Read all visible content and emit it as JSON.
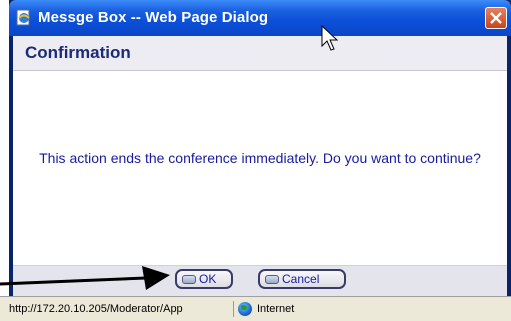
{
  "window": {
    "title": "Messge Box -- Web Page Dialog",
    "close_icon": "close-icon"
  },
  "dialog": {
    "heading": "Confirmation",
    "message": "This action ends the conference immediately. Do you want to continue?",
    "buttons": {
      "ok_label": "OK",
      "cancel_label": "Cancel"
    }
  },
  "statusbar": {
    "url": "http://172.20.10.205/Moderator/App",
    "zone": "Internet"
  },
  "colors": {
    "title_bar": "#0b4fd8",
    "heading_text": "#1c2a7a",
    "message_text": "#1a1aa0"
  }
}
